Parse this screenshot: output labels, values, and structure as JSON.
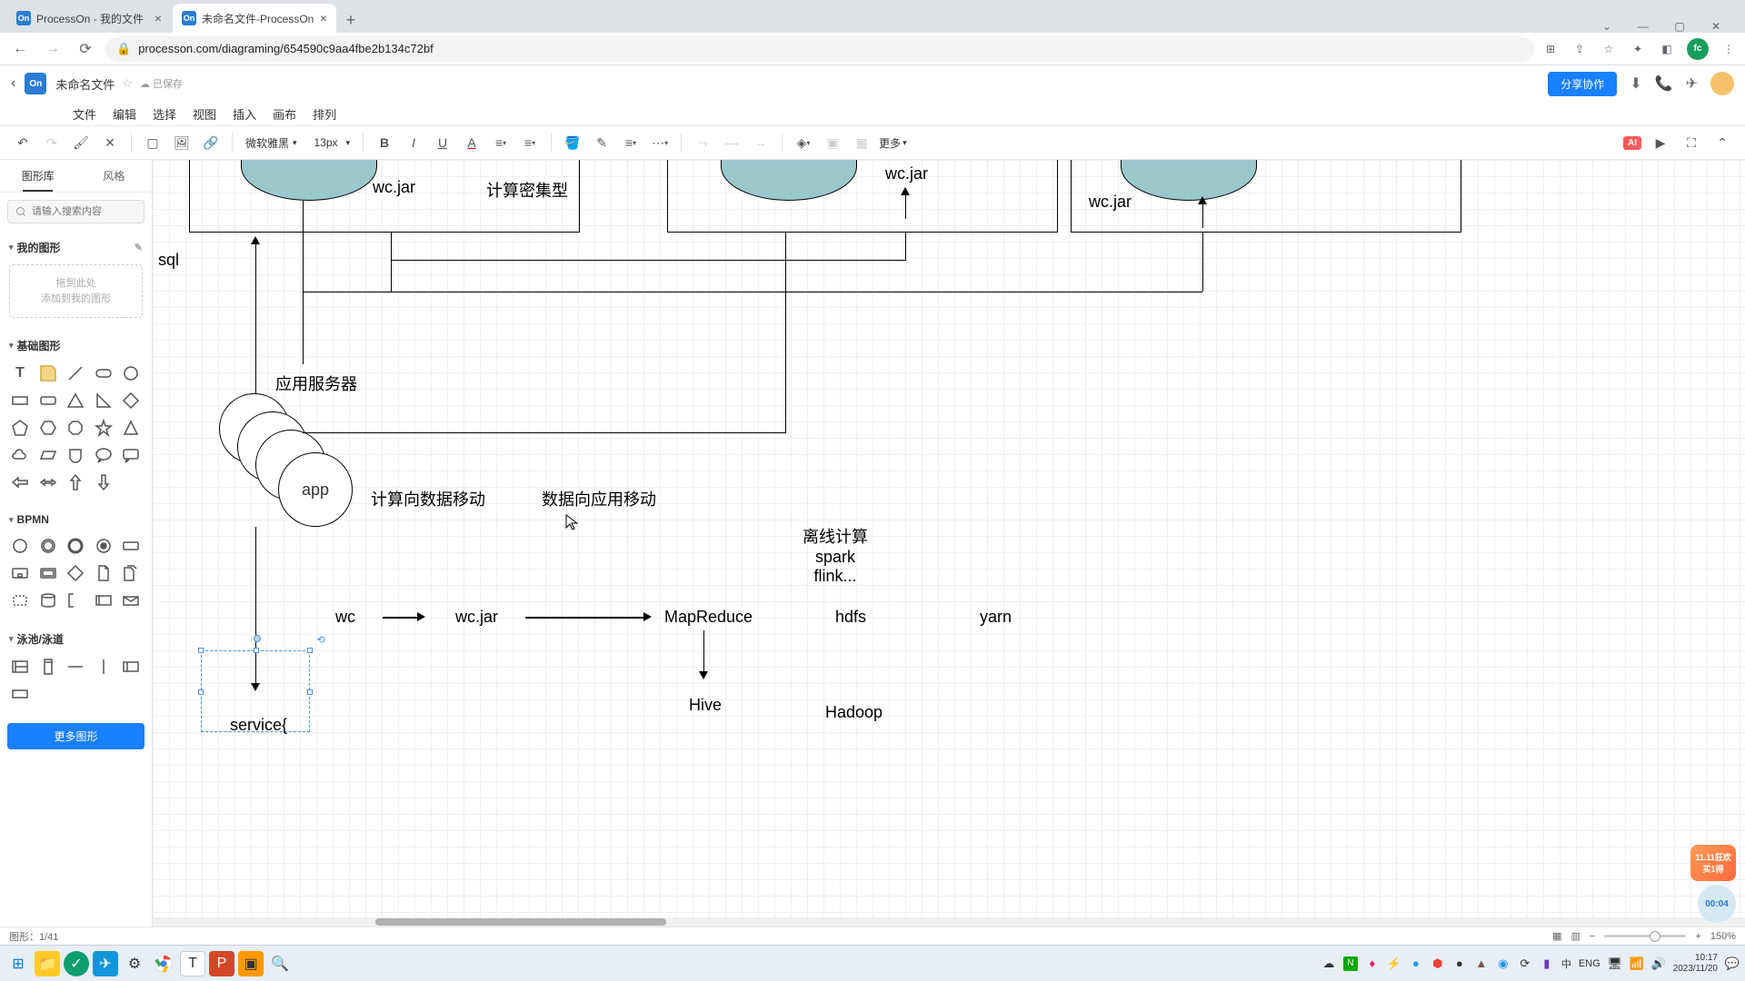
{
  "browser": {
    "tabs": [
      {
        "favicon": "On",
        "title": "ProcessOn - 我的文件"
      },
      {
        "favicon": "On",
        "title": "未命名文件-ProcessOn"
      }
    ],
    "url": "processon.com/diagraming/654590c9aa4fbe2b134c72bf"
  },
  "windowControls": {
    "dropdown": "⌄",
    "min": "—",
    "max": "▢",
    "close": "✕"
  },
  "appHeader": {
    "docTitle": "未命名文件",
    "savedIcon": "☁",
    "savedText": "已保存",
    "shareBtn": "分享协作"
  },
  "menuBar": [
    "文件",
    "编辑",
    "选择",
    "视图",
    "插入",
    "画布",
    "排列"
  ],
  "toolbar": {
    "fontFamily": "微软雅黑",
    "fontSize": "13px",
    "more": "更多",
    "aiBadge": "AI"
  },
  "sidebar": {
    "tabShapes": "图形库",
    "tabStyle": "风格",
    "searchPlaceholder": "请输入搜索内容",
    "myShapes": "我的图形",
    "dropZoneLine1": "拖到此处",
    "dropZoneLine2": "添加到我的图形",
    "basicShapes": "基础图形",
    "bpmn": "BPMN",
    "swimlane": "泳池/泳道",
    "moreShapesBtn": "更多图形"
  },
  "canvas": {
    "sql": "sql",
    "wcjar1": "wc.jar",
    "computeIntensive": "计算密集型",
    "wcjar2": "wc.jar",
    "wcjar3": "wc.jar",
    "appServer": "应用服务器",
    "app": "app",
    "computeToData": "计算向数据移动",
    "dataToApp": "数据向应用移动",
    "offlineCompute": "离线计算\nspark\nflink...",
    "wc": "wc",
    "wcjarMid": "wc.jar",
    "mapreduce": "MapReduce",
    "hdfs": "hdfs",
    "yarn": "yarn",
    "hive": "Hive",
    "hadoop": "Hadoop",
    "service": "service{"
  },
  "promo": {
    "line1": "11.11狂欢",
    "line2": "买1得"
  },
  "timer": "00:04",
  "statusBar": {
    "shapeCount": "图形：1/41",
    "zoom": "150%"
  },
  "tray": {
    "lang1": "中",
    "lang2": "ENG",
    "time": "10:17",
    "date": "2023/11/20"
  }
}
